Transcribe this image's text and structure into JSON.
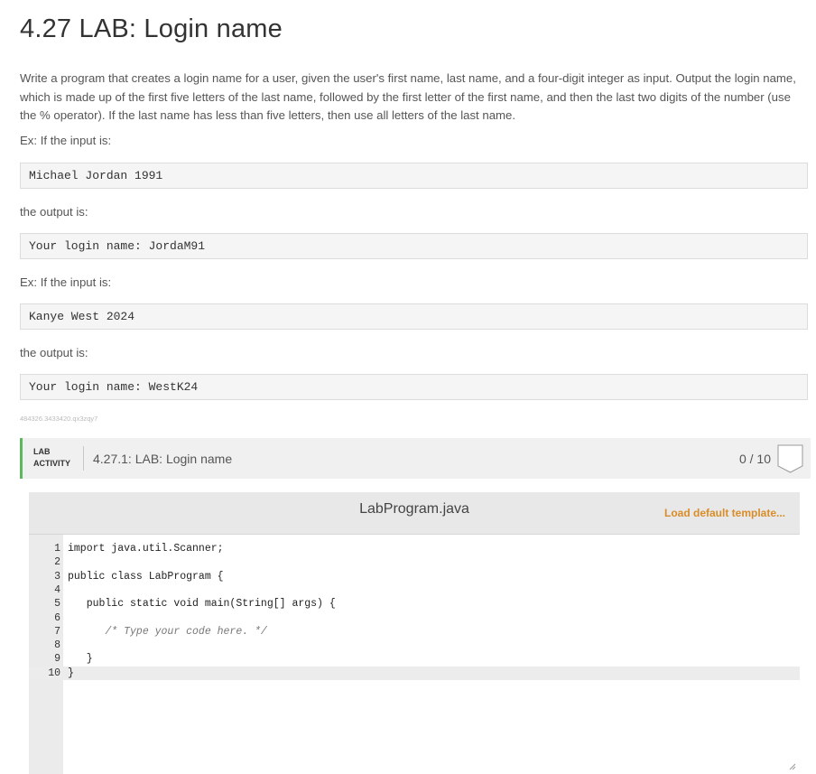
{
  "page": {
    "title": "4.27 LAB: Login name",
    "description": "Write a program that creates a login name for a user, given the user's first name, last name, and a four-digit integer as input. Output the login name, which is made up of the first five letters of the last name, followed by the first letter of the first name, and then the last two digits of the number (use the % operator). If the last name has less than five letters, then use all letters of the last name.",
    "examples": [
      {
        "intro": "Ex: If the input is:",
        "input": "Michael Jordan 1991",
        "output_intro": "the output is:",
        "output": "Your login name: JordaM91"
      },
      {
        "intro": "Ex: If the input is:",
        "input": "Kanye West 2024",
        "output_intro": "the output is:",
        "output": "Your login name: WestK24"
      }
    ],
    "activity_id": "484326.3433420.qx3zqy7"
  },
  "lab": {
    "tag_line1": "LAB",
    "tag_line2": "ACTIVITY",
    "name": "4.27.1: LAB: Login name",
    "score": "0 / 10",
    "accent_color": "#5cb85c"
  },
  "editor": {
    "filename": "LabProgram.java",
    "load_default": "Load default template...",
    "link_color": "#d98d28",
    "lines": [
      {
        "n": "1",
        "code": "import java.util.Scanner;"
      },
      {
        "n": "2",
        "code": ""
      },
      {
        "n": "3",
        "code": "public class LabProgram {"
      },
      {
        "n": "4",
        "code": ""
      },
      {
        "n": "5",
        "code": "   public static void main(String[] args) {"
      },
      {
        "n": "6",
        "code": ""
      },
      {
        "n": "7",
        "code": "      /* Type your code here. */"
      },
      {
        "n": "8",
        "code": ""
      },
      {
        "n": "9",
        "code": "   }"
      },
      {
        "n": "10",
        "code": "}"
      }
    ]
  }
}
